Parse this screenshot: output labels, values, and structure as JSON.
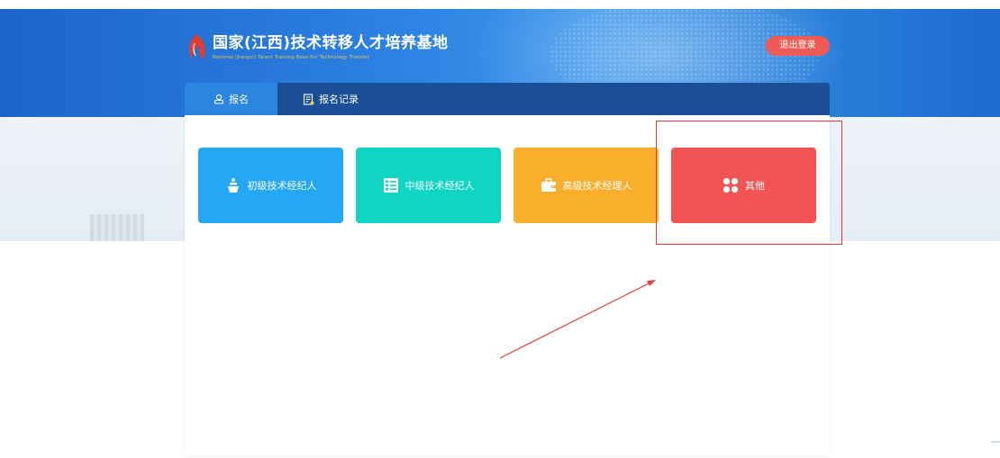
{
  "header": {
    "title": "国家(江西)技术转移人才培养基地",
    "subtitle": "National (Jiangxi) Talent Training Base For Technology Transfer",
    "logout_label": "退出登录"
  },
  "tabs": [
    {
      "label": "报名",
      "icon": "user-icon",
      "active": true
    },
    {
      "label": "报名记录",
      "icon": "document-list-icon",
      "active": false
    }
  ],
  "cards": [
    {
      "label": "初级技术经纪人",
      "icon": "podium-icon",
      "color": "#25a8f4"
    },
    {
      "label": "中级技术经纪人",
      "icon": "list-layout-icon",
      "color": "#10d5c2"
    },
    {
      "label": "高级技术经理人",
      "icon": "briefcase-icon",
      "color": "#f9ae2c"
    },
    {
      "label": "其他",
      "icon": "four-dots-icon",
      "color": "#f15453"
    }
  ],
  "colors": {
    "header_blue": "#2a7ee0",
    "tabbar": "#1b4f95",
    "logout": "#ee5b54",
    "annotation_red": "#e03a3a"
  }
}
